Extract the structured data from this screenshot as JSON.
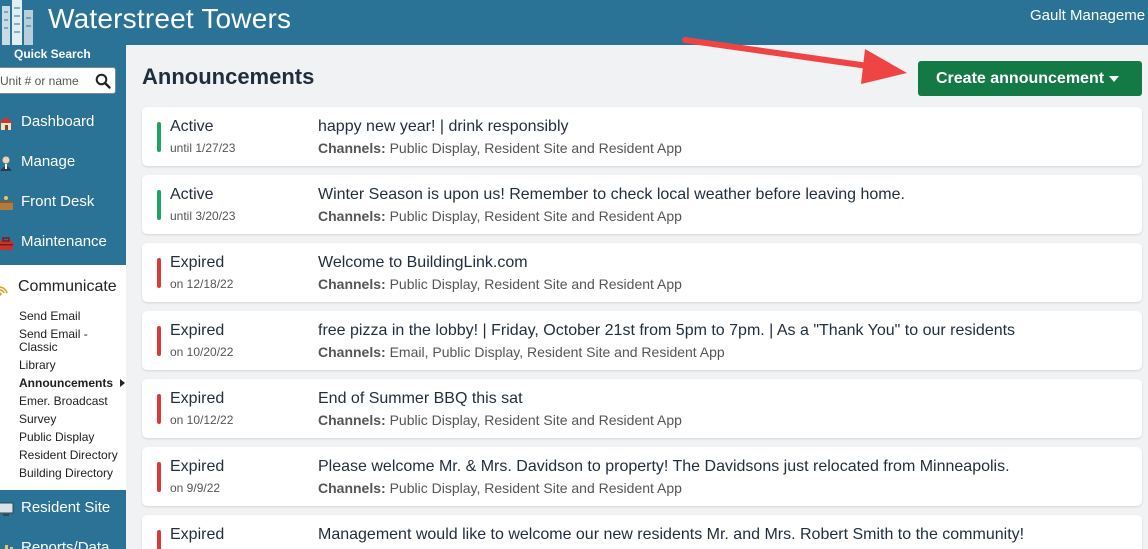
{
  "header": {
    "site_title": "Waterstreet Towers",
    "management": "Gault Manageme"
  },
  "sidebar": {
    "quick_search_label": "Quick Search",
    "quick_search_placeholder": "Unit # or name",
    "nav": [
      {
        "label": "Dashboard",
        "icon": "house-icon"
      },
      {
        "label": "Manage",
        "icon": "person-icon"
      },
      {
        "label": "Front Desk",
        "icon": "desk-icon"
      },
      {
        "label": "Maintenance",
        "icon": "toolbox-icon"
      }
    ],
    "communicate": {
      "label": "Communicate",
      "icon": "broadcast-icon",
      "items": [
        {
          "label": "Send Email"
        },
        {
          "label": "Send Email -"
        },
        {
          "label": "Classic"
        },
        {
          "label": "Library"
        },
        {
          "label": "Announcements",
          "active": true
        },
        {
          "label": "Emer. Broadcast"
        },
        {
          "label": "Survey"
        },
        {
          "label": "Public Display"
        },
        {
          "label": "Resident Directory"
        },
        {
          "label": "Building Directory"
        }
      ]
    },
    "resident_site": {
      "label": "Resident Site",
      "icon": "monitor-icon"
    },
    "reports": {
      "label": "Reports/Data",
      "icon": "chart-icon"
    }
  },
  "main": {
    "title": "Announcements",
    "create_button": "Create announcement",
    "channels_label": "Channels:",
    "announcements": [
      {
        "status": "Active",
        "date": "until 1/27/23",
        "title": "happy new year! | drink responsibly",
        "channels": "Public Display, Resident Site and Resident App",
        "color": "#1ea364"
      },
      {
        "status": "Active",
        "date": "until 3/20/23",
        "title": "Winter Season is upon us! Remember to check local weather before leaving home.",
        "channels": "Public Display, Resident Site and Resident App",
        "color": "#1ea364"
      },
      {
        "status": "Expired",
        "date": "on 12/18/22",
        "title": "Welcome to BuildingLink.com",
        "channels": "Public Display, Resident Site and Resident App",
        "color": "#d93a3a"
      },
      {
        "status": "Expired",
        "date": "on 10/20/22",
        "title": "free pizza in the lobby! | Friday, October 21st from 5pm to 7pm. | As a \"Thank You\" to our residents",
        "channels": "Email, Public Display, Resident Site and Resident App",
        "color": "#d93a3a"
      },
      {
        "status": "Expired",
        "date": "on 10/12/22",
        "title": "End of Summer BBQ this sat",
        "channels": "Public Display, Resident Site and Resident App",
        "color": "#d93a3a"
      },
      {
        "status": "Expired",
        "date": "on 9/9/22",
        "title": "Please welcome Mr. & Mrs. Davidson to property! The Davidsons just relocated from Minneapolis.",
        "channels": "Public Display, Resident Site and Resident App",
        "color": "#d93a3a"
      },
      {
        "status": "Expired",
        "date": "",
        "title": "Management would like to welcome our new residents Mr. and Mrs. Robert Smith to the community!",
        "channels": "",
        "color": "#d93a3a"
      }
    ]
  }
}
